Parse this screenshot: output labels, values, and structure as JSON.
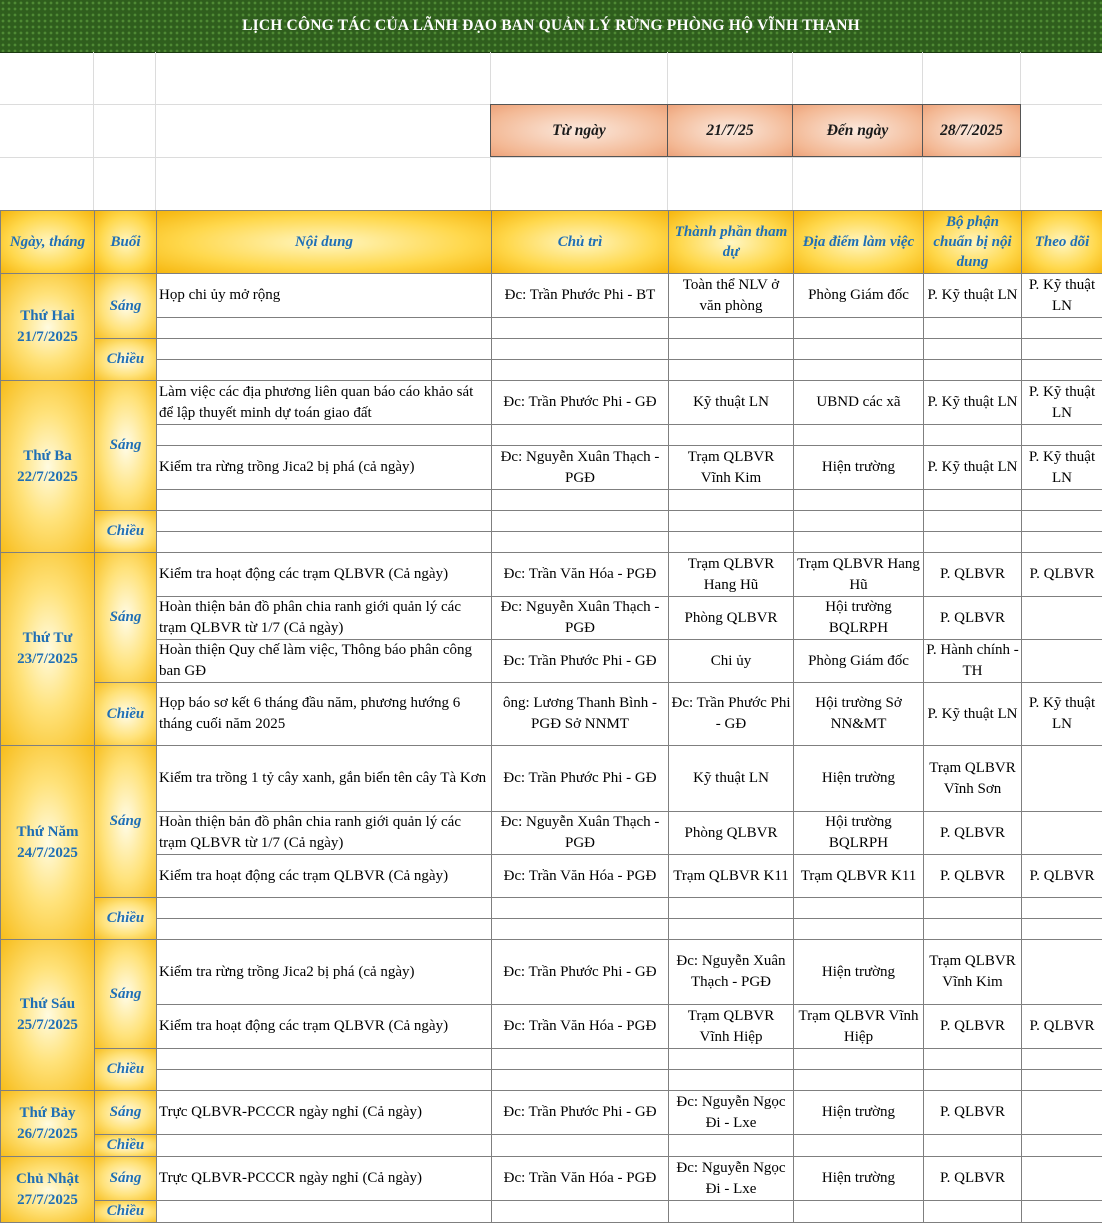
{
  "title": "LỊCH CÔNG TÁC CỦA LÃNH ĐẠO BAN QUẢN LÝ RỪNG PHÒNG HỘ VĨNH THẠNH",
  "range": {
    "from_label": "Từ ngày",
    "from_value": "21/7/25",
    "to_label": "Đến ngày",
    "to_value": "28/7/2025"
  },
  "headers": {
    "date": "Ngày, tháng",
    "session": "Buổi",
    "content": "Nội dung",
    "chair": "Chủ trì",
    "participants": "Thành phần tham dự",
    "location": "Địa điểm làm việc",
    "prep": "Bộ phận chuẩn bị nội dung",
    "follow": "Theo dõi"
  },
  "days": [
    {
      "name": "Thứ Hai",
      "date": "21/7/2025"
    },
    {
      "name": "Thứ Ba",
      "date": "22/7/2025"
    },
    {
      "name": "Thứ Tư",
      "date": "23/7/2025"
    },
    {
      "name": "Thứ Năm",
      "date": "24/7/2025"
    },
    {
      "name": "Thứ Sáu",
      "date": "25/7/2025"
    },
    {
      "name": "Thứ Bảy",
      "date": "26/7/2025"
    },
    {
      "name": "Chủ Nhật",
      "date": "27/7/2025"
    }
  ],
  "sessions": {
    "morning": "Sáng",
    "afternoon": "Chiều"
  },
  "rows": [
    {
      "content": "Họp chi ủy mở rộng",
      "chair": "Đc: Trần Phước Phi - BT",
      "participants": "Toàn thể NLV ở văn phòng",
      "location": "Phòng Giám đốc",
      "prep": "P. Kỹ thuật LN",
      "follow": "P. Kỹ thuật LN"
    },
    {
      "content": "Làm việc các địa phương liên quan báo cáo khảo sát để lập thuyết minh dự toán giao đất",
      "chair": "Đc: Trần Phước Phi - GĐ",
      "participants": "Kỹ thuật LN",
      "location": "UBND các xã",
      "prep": "P. Kỹ thuật LN",
      "follow": "P. Kỹ thuật LN"
    },
    {
      "content": "Kiểm tra rừng trồng Jica2 bị phá (cả ngày)",
      "chair": "Đc: Nguyễn Xuân Thạch - PGĐ",
      "participants": "Trạm QLBVR Vĩnh Kim",
      "location": "Hiện trường",
      "prep": "P. Kỹ thuật LN",
      "follow": "P. Kỹ thuật LN"
    },
    {
      "content": "Kiểm tra hoạt động các trạm QLBVR (Cả ngày)",
      "chair": "Đc: Trần Văn Hóa - PGĐ",
      "participants": "Trạm QLBVR Hang Hũ",
      "location": "Trạm QLBVR Hang Hũ",
      "prep": "P. QLBVR",
      "follow": "P. QLBVR"
    },
    {
      "content": "Hoàn thiện bản đồ phân chia ranh giới quản lý các trạm QLBVR từ 1/7 (Cả ngày)",
      "chair": "Đc: Nguyễn Xuân Thạch - PGĐ",
      "participants": "Phòng QLBVR",
      "location": "Hội trường BQLRPH",
      "prep": "P. QLBVR",
      "follow": ""
    },
    {
      "content": "Hoàn thiện Quy chế làm việc, Thông báo phân công ban GĐ",
      "chair": "Đc: Trần Phước Phi - GĐ",
      "participants": "Chi ủy",
      "location": "Phòng Giám đốc",
      "prep": "P. Hành chính - TH",
      "follow": ""
    },
    {
      "content": "Họp báo sơ kết 6 tháng đầu năm, phương hướng 6 tháng cuối năm 2025",
      "chair": "ông: Lương Thanh Bình - PGĐ Sở NNMT",
      "participants": "Đc: Trần Phước Phi - GĐ",
      "location": "Hội trường Sở NN&MT",
      "prep": "P. Kỹ thuật LN",
      "follow": "P. Kỹ thuật LN"
    },
    {
      "content": "Kiểm tra trồng 1 tỷ cây xanh, gắn biển tên cây Tà Kơn",
      "chair": "Đc: Trần Phước Phi - GĐ",
      "participants": "Kỹ thuật LN",
      "location": "Hiện trường",
      "prep": "Trạm QLBVR Vĩnh Sơn",
      "follow": ""
    },
    {
      "content": "Hoàn thiện bản đồ phân chia ranh giới quản lý các trạm QLBVR từ 1/7 (Cả ngày)",
      "chair": "Đc: Nguyễn Xuân Thạch - PGĐ",
      "participants": "Phòng QLBVR",
      "location": "Hội trường BQLRPH",
      "prep": "P. QLBVR",
      "follow": ""
    },
    {
      "content": "Kiểm tra hoạt động các trạm QLBVR (Cả ngày)",
      "chair": "Đc: Trần Văn Hóa - PGĐ",
      "participants": "Trạm QLBVR K11",
      "location": "Trạm QLBVR K11",
      "prep": "P. QLBVR",
      "follow": "P. QLBVR"
    },
    {
      "content": "Kiểm tra rừng trồng Jica2 bị phá (cả ngày)",
      "chair": "Đc: Trần Phước Phi - GĐ",
      "participants": "Đc: Nguyễn Xuân Thạch - PGĐ",
      "location": "Hiện trường",
      "prep": "Trạm QLBVR Vĩnh Kim",
      "follow": ""
    },
    {
      "content": "Kiểm tra hoạt động các trạm QLBVR (Cả ngày)",
      "chair": "Đc: Trần Văn Hóa - PGĐ",
      "participants": "Trạm QLBVR Vĩnh Hiệp",
      "location": "Trạm QLBVR Vĩnh Hiệp",
      "prep": "P. QLBVR",
      "follow": "P. QLBVR"
    },
    {
      "content": "Trực QLBVR-PCCCR ngày nghỉ (Cả ngày)",
      "chair": "Đc: Trần Phước Phi - GĐ",
      "participants": "Đc: Nguyễn Ngọc Đi - Lxe",
      "location": "Hiện trường",
      "prep": "P. QLBVR",
      "follow": ""
    },
    {
      "content": "Trực QLBVR-PCCCR ngày nghỉ (Cả ngày)",
      "chair": "Đc: Trần Văn Hóa - PGĐ",
      "participants": "Đc: Nguyễn Ngọc Đi - Lxe",
      "location": "Hiện trường",
      "prep": "P. QLBVR",
      "follow": ""
    }
  ]
}
